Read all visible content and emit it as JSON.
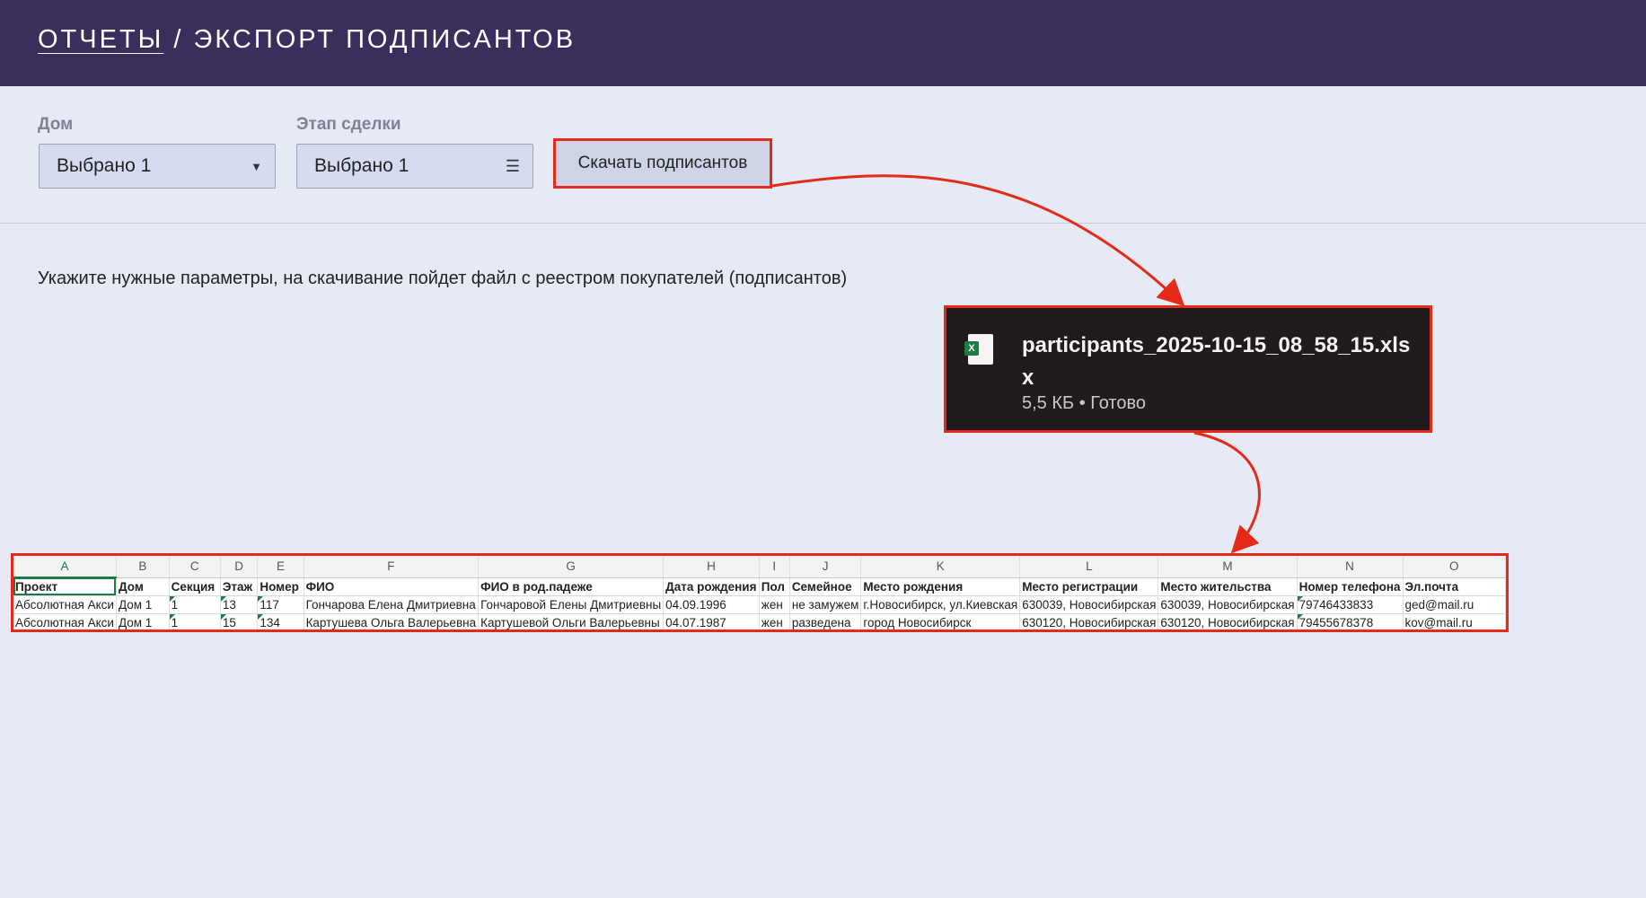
{
  "header": {
    "breadcrumb_link": "ОТЧЕТЫ",
    "separator": " / ",
    "title": "ЭКСПОРТ ПОДПИСАНТОВ"
  },
  "filters": {
    "house": {
      "label": "Дом",
      "value": "Выбрано 1"
    },
    "stage": {
      "label": "Этап сделки",
      "value": "Выбрано 1"
    },
    "download_button": "Скачать подписантов"
  },
  "hint": "Укажите нужные параметры, на скачивание пойдет файл с реестром покупателей (подписантов)",
  "download": {
    "filename": "participants_2025-10-15_08_58_15.xlsx",
    "meta": "5,5 КБ • Готово",
    "icon": "excel-file-icon"
  },
  "sheet": {
    "columns": [
      "A",
      "B",
      "C",
      "D",
      "E",
      "F",
      "G",
      "H",
      "I",
      "J",
      "K",
      "L",
      "M",
      "N",
      "O"
    ],
    "headers": [
      "Проект",
      "Дом",
      "Секция",
      "Этаж",
      "Номер",
      "ФИО",
      "ФИО в род.падеже",
      "Дата рождения",
      "Пол",
      "Семейное",
      "Место рождения",
      "Место регистрации",
      "Место жительства",
      "Номер телефона",
      "Эл.почта"
    ],
    "rows": [
      [
        "Абсолютная Акси",
        "Дом 1",
        "1",
        "13",
        "117",
        "Гончарова Елена Дмитриевна",
        "Гончаровой Елены Дмитриевны",
        "04.09.1996",
        "жен",
        "не замужем",
        "г.Новосибирск, ул.Киевская",
        "630039, Новосибирская",
        "630039, Новосибирская",
        "79746433833",
        "ged@mail.ru"
      ],
      [
        "Абсолютная Акси",
        "Дом 1",
        "1",
        "15",
        "134",
        "Картушева Ольга Валерьевна",
        "Картушевой Ольги Валерьевны",
        "04.07.1987",
        "жен",
        "разведена",
        "город Новосибирск",
        "630120, Новосибирская",
        "630120, Новосибирская",
        "79455678378",
        "kov@mail.ru"
      ]
    ]
  },
  "colors": {
    "header_bg": "#3c2e5c",
    "highlight": "#e52a1a",
    "excel_green": "#1f7a43"
  }
}
